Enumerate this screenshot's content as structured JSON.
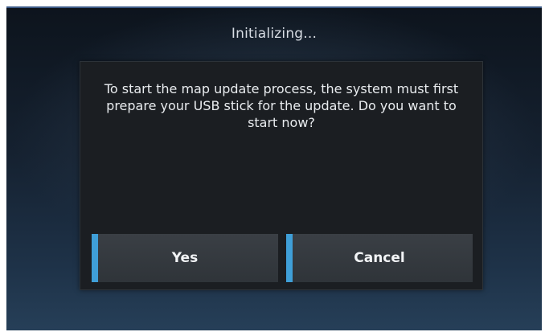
{
  "screen": {
    "title": "Initializing..."
  },
  "dialog": {
    "message": "To start the map update process, the system must first prepare your USB stick for the update. Do you want to start now?",
    "buttons": {
      "yes_label": "Yes",
      "cancel_label": "Cancel"
    }
  },
  "colors": {
    "button_accent": "#3f9fd8",
    "dialog_background": "#1b1e22",
    "button_background": "#33383d",
    "background_top": "#0d141d",
    "background_bottom": "#263f58"
  }
}
